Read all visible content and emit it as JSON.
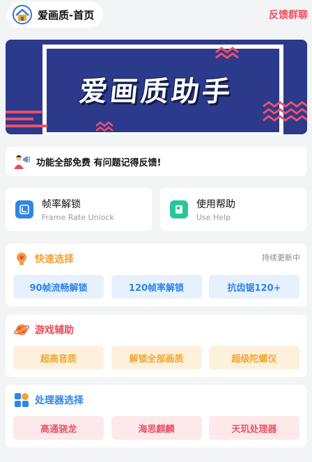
{
  "header": {
    "title": "爱画质-首页",
    "feedback_link": "反馈群聊",
    "logo_icon": "house-logo-icon"
  },
  "banner": {
    "text": "爱画质助手"
  },
  "notice": {
    "text": "功能全部免费 有问题记得反馈!",
    "icon": "megaphone-person-icon"
  },
  "features": [
    {
      "title": "帧率解锁",
      "subtitle": "Frame Rate Unlock",
      "icon": "frame-rate-icon",
      "color": "#2f86e6"
    },
    {
      "title": "使用帮助",
      "subtitle": "Use Help",
      "icon": "help-book-icon",
      "color": "#25c79a"
    }
  ],
  "sections": [
    {
      "title": "快速选择",
      "aside": "持续更新中",
      "icon": "lightbulb-icon",
      "buttons": [
        "90帧流畅解锁",
        "120帧率解锁",
        "抗齿锯120+"
      ]
    },
    {
      "title": "游戏辅助",
      "aside": "",
      "icon": "planet-icon",
      "buttons": [
        "超高音质",
        "解锁全部画质",
        "超级陀螺仪"
      ]
    },
    {
      "title": "处理器选择",
      "aside": "",
      "icon": "processor-icon",
      "buttons": [
        "高通骁龙",
        "海思麒麟",
        "天玑处理器"
      ]
    }
  ],
  "colors": {
    "accent_blue": "#2f86e6",
    "accent_orange": "#f3a03a",
    "accent_red": "#e84b57",
    "banner_bg": "#2b3a8a"
  }
}
